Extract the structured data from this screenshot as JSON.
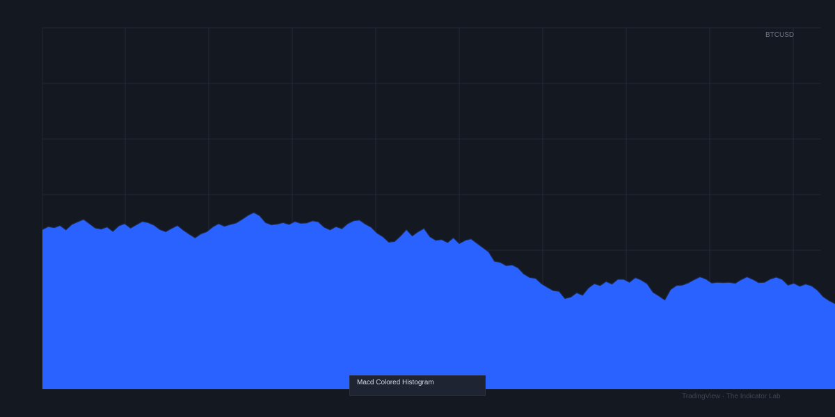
{
  "symbol": "BTCUSD",
  "indicator_label": "Macd Colored Histogram",
  "watermark": "TradingView · The Indicator Lab",
  "colors": {
    "background": "#141821",
    "grid": "#232836",
    "area_fill": "#2962ff",
    "area_line": "#1e2a4a"
  },
  "chart_data": {
    "type": "area",
    "title": "",
    "xlabel": "",
    "ylabel": "",
    "grid": true,
    "legend": "none",
    "ylim": [
      0,
      100
    ],
    "series": [
      {
        "color": "#2962ff",
        "values": [
          44.2,
          45.0,
          44.7,
          45.3,
          44.1,
          45.6,
          46.3,
          47.0,
          45.8,
          44.6,
          44.3,
          44.9,
          43.7,
          45.2,
          45.8,
          44.6,
          45.5,
          46.4,
          46.1,
          45.4,
          44.2,
          43.6,
          44.5,
          45.3,
          44.0,
          42.9,
          41.9,
          43.0,
          43.6,
          44.9,
          45.8,
          45.1,
          45.6,
          46.0,
          47.0,
          48.1,
          48.9,
          48.0,
          46.1,
          45.5,
          45.7,
          46.1,
          45.6,
          46.4,
          45.9,
          46.0,
          46.6,
          46.3,
          44.8,
          44.1,
          45.0,
          44.4,
          45.8,
          46.6,
          46.8,
          45.7,
          44.8,
          43.2,
          42.2,
          40.7,
          40.9,
          42.4,
          44.2,
          42.4,
          43.6,
          44.5,
          42.2,
          41.2,
          41.4,
          40.6,
          41.9,
          40.3,
          41.2,
          41.6,
          40.4,
          39.2,
          38.0,
          35.4,
          35.1,
          34.2,
          34.4,
          33.6,
          31.9,
          30.9,
          30.7,
          29.2,
          28.2,
          27.3,
          27.1,
          25.1,
          25.5,
          26.7,
          26.0,
          28.0,
          29.2,
          28.7,
          29.8,
          29.1,
          30.4,
          30.4,
          29.6,
          30.9,
          30.2,
          29.2,
          26.8,
          25.8,
          24.7,
          27.6,
          28.7,
          28.8,
          29.4,
          30.3,
          31.1,
          30.5,
          29.4,
          29.6,
          29.5,
          29.6,
          29.3,
          30.3,
          31.1,
          30.4,
          29.5,
          29.6,
          30.5,
          31.0,
          30.4,
          28.8,
          29.3,
          28.5,
          29.1,
          28.6,
          27.4,
          25.6,
          24.5,
          23.7
        ]
      }
    ]
  }
}
